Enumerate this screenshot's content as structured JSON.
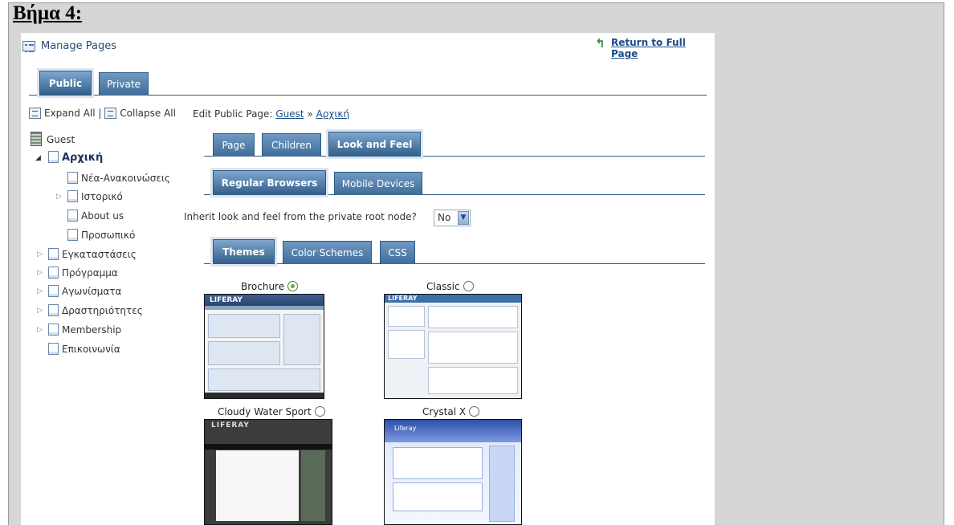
{
  "document": {
    "step_title": "Βήμα 4:"
  },
  "header": {
    "title": "Manage Pages",
    "return_link": "Return to Full Page"
  },
  "site_tabs": [
    {
      "label": "Public",
      "active": true
    },
    {
      "label": "Private",
      "active": false
    }
  ],
  "tree_tools": {
    "expand_all": "Expand All",
    "separator": "|",
    "collapse_all": "Collapse All"
  },
  "tree": {
    "root": "Guest",
    "items": [
      {
        "label": "Αρχική",
        "selected": true,
        "expanded": true
      },
      {
        "label": "Νέα-Ανακοινώσεις"
      },
      {
        "label": "Ιστορικό",
        "has_children": true
      },
      {
        "label": "About us"
      },
      {
        "label": "Προσωπικό"
      },
      {
        "label": "Εγκαταστάσεις",
        "has_children": true
      },
      {
        "label": "Πρόγραμμα",
        "has_children": true
      },
      {
        "label": "Αγωνίσματα",
        "has_children": true
      },
      {
        "label": "Δραστηριότητες",
        "has_children": true
      },
      {
        "label": "Membership",
        "has_children": true
      },
      {
        "label": "Επικοινωνία"
      }
    ]
  },
  "edit": {
    "prefix": "Edit Public Page:",
    "crumb_guest": "Guest",
    "sep": "»",
    "crumb_page": "Αρχική"
  },
  "page_tabs": [
    {
      "label": "Page"
    },
    {
      "label": "Children"
    },
    {
      "label": "Look and Feel",
      "active": true
    }
  ],
  "browser_tabs": [
    {
      "label": "Regular Browsers",
      "active": true
    },
    {
      "label": "Mobile Devices"
    }
  ],
  "inherit": {
    "label": "Inherit look and feel from the private root node?",
    "value": "No"
  },
  "theme_tabs": [
    {
      "label": "Themes",
      "active": true
    },
    {
      "label": "Color Schemes"
    },
    {
      "label": "CSS"
    }
  ],
  "themes": [
    {
      "name": "Brochure",
      "selected": true,
      "thumb_logo": "LIFERAY"
    },
    {
      "name": "Classic",
      "selected": false,
      "thumb_logo": "LIFERAY"
    },
    {
      "name": "Cloudy Water Sport",
      "selected": false,
      "thumb_logo": "LIFERAY"
    },
    {
      "name": "Crystal X",
      "selected": false,
      "thumb_logo": "Liferay"
    }
  ],
  "colors": {
    "tab_blue": "#3f6d99",
    "link_blue": "#1a4c8a",
    "radio_green": "#5cb33a"
  }
}
